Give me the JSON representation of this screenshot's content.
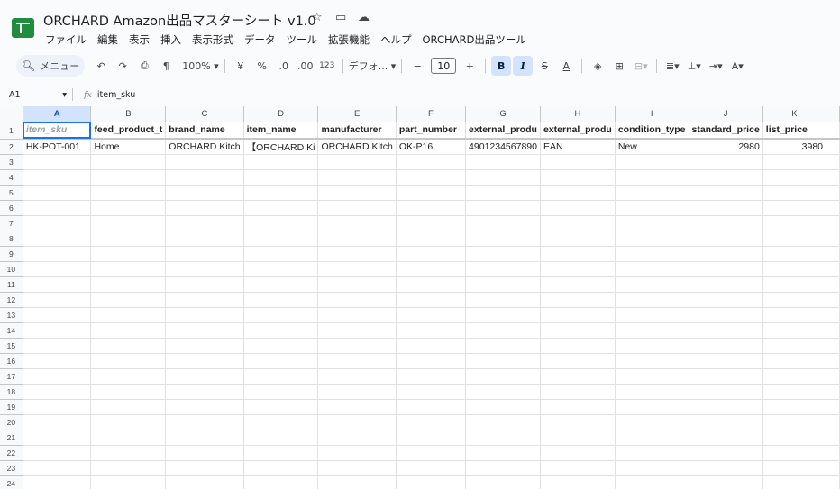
{
  "title": "ORCHARD Amazon出品マスターシート v1.0",
  "title_icons": [
    "star-icon",
    "move-to-folder-icon",
    "cloud-status-icon"
  ],
  "menu": [
    "ファイル",
    "編集",
    "表示",
    "挿入",
    "表示形式",
    "データ",
    "ツール",
    "拡張機能",
    "ヘルプ",
    "ORCHARD出品ツール"
  ],
  "toolbar": {
    "search_label": "メニュー",
    "zoom": "100%",
    "currency": "¥",
    "percent": "%",
    "dec_decrease": ".0",
    "dec_increase": ".00",
    "format_123": "123",
    "font": "デフォ...",
    "font_size": "10",
    "bold": "B",
    "italic": "I",
    "strike": "S",
    "text_color": "A"
  },
  "formula_bar": {
    "cell_ref": "A1",
    "fx": "fx",
    "content": "item_sku"
  },
  "grid": {
    "columns": [
      "A",
      "B",
      "C",
      "D",
      "E",
      "F",
      "G",
      "H",
      "I",
      "J",
      "K"
    ],
    "headers": [
      "item_sku",
      "feed_product_t",
      "brand_name",
      "item_name",
      "manufacturer",
      "part_number",
      "external_produ",
      "external_produ",
      "condition_type",
      "standard_price",
      "list_price"
    ],
    "rows": [
      [
        "HK-POT-001",
        "Home",
        "ORCHARD Kitch",
        "【ORCHARD Ki",
        "ORCHARD Kitch",
        "OK-P16",
        "4901234567890",
        "EAN",
        "New",
        "2980",
        "3980"
      ]
    ],
    "row_numbers": [
      "1",
      "2",
      "3",
      "4",
      "5",
      "6",
      "7",
      "8",
      "9",
      "10",
      "11",
      "12",
      "13",
      "14",
      "15",
      "16",
      "17",
      "18",
      "19",
      "20",
      "21",
      "22",
      "23",
      "24"
    ]
  }
}
